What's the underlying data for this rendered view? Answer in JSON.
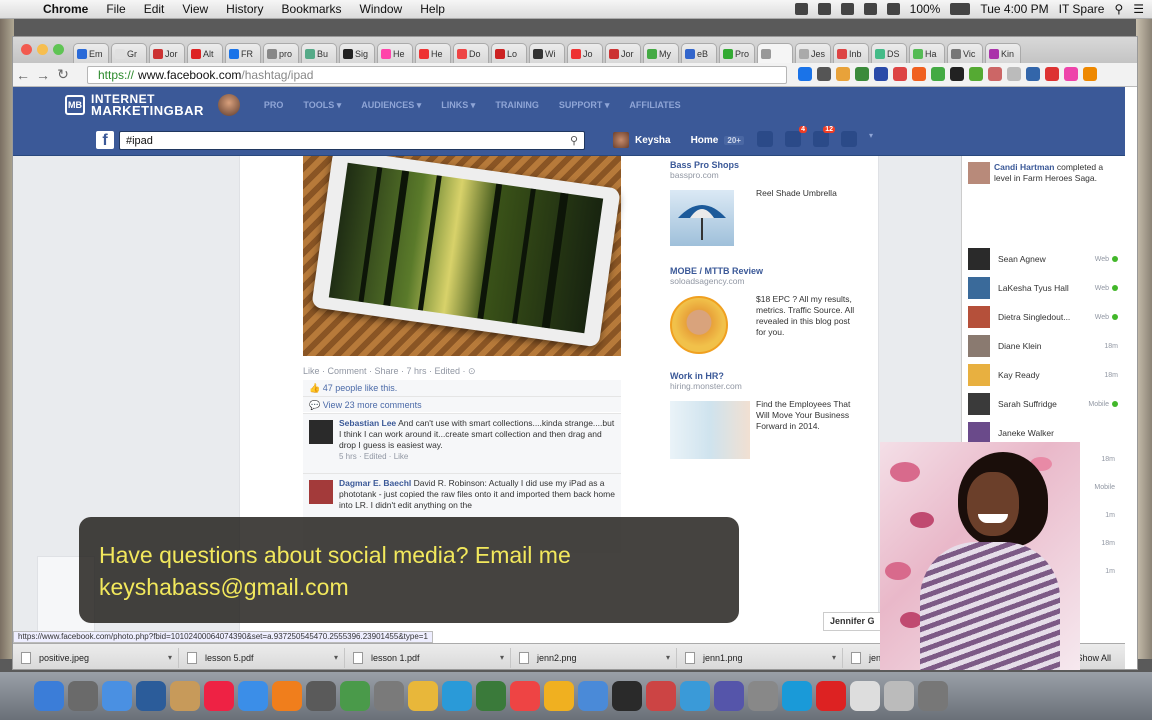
{
  "menubar": {
    "app": "Chrome",
    "items": [
      "File",
      "Edit",
      "View",
      "History",
      "Bookmarks",
      "Window",
      "Help"
    ],
    "battery": "100%",
    "clock": "Tue 4:00 PM",
    "user": "IT Spare"
  },
  "browser": {
    "tabs": [
      "Em",
      "Gr",
      "Jor",
      "Alt",
      "FR",
      "pro",
      "Bu",
      "Sig",
      "He",
      "He",
      "Do",
      "Lo",
      "Wi",
      "Jo",
      "Jor",
      "My",
      "eB",
      "Pro",
      "",
      "Jes",
      "Inb",
      "DS",
      "Ha",
      "Vic",
      "Kin"
    ],
    "url_scheme": "https://",
    "url_host": "www.facebook.com",
    "url_path": "/hashtag/ipad",
    "status_url": "https://www.facebook.com/photo.php?fbid=10102400064074390&set=a.937250545470.2555396.23901455&type=1"
  },
  "imb": {
    "logo_line1": "INTERNET",
    "logo_line2": "MARKETINGBAR",
    "logo_mark": "MB",
    "nav": [
      "PRO",
      "TOOLS ▾",
      "AUDIENCES ▾",
      "LINKS ▾",
      "TRAINING",
      "SUPPORT ▾",
      "AFFILIATES"
    ]
  },
  "fb": {
    "search_value": "#ipad",
    "user_name": "Keysha",
    "home": "Home",
    "home_count": "20+",
    "notif_messages": "4",
    "notif_alerts": "12"
  },
  "post": {
    "actions": "Like · Comment · Share · 7 hrs · Edited · ⊙",
    "likes": "47 people like this.",
    "view_more": "View 23 more comments",
    "comments": [
      {
        "name": "Sebastian Lee",
        "text": "And can't use with smart collections....kinda strange....but I think I can work around it...create smart collection and then drag and drop I guess is easiest way.",
        "meta": "5 hrs · Edited · Like"
      },
      {
        "name": "Dagmar E. Baechl",
        "text": "David R. Robinson: Actually I did use my iPad as a phototank - just copied the raw files onto it and imported them back home into LR. I didn't edit anything on the",
        "meta": ""
      }
    ]
  },
  "ads": [
    {
      "title": "Bass Pro Shops",
      "url": "basspro.com",
      "desc": "Reel Shade Umbrella"
    },
    {
      "title": "MOBE / MTTB Review",
      "url": "soloadsagency.com",
      "desc": "$18 EPC ? All my results, metrics. Traffic Source. All revealed in this blog post for you."
    },
    {
      "title": "Work in HR?",
      "url": "hiring.monster.com",
      "desc": "Find the Employees That Will Move Your Business Forward in 2014."
    }
  ],
  "ticker": {
    "name": "Candi Hartman",
    "text": "completed a level in Farm Heroes Saga."
  },
  "chat": [
    {
      "name": "Sean Agnew",
      "status": "Web"
    },
    {
      "name": "LaKesha Tyus Hall",
      "status": "Web"
    },
    {
      "name": "Dietra Singledout...",
      "status": "Web"
    },
    {
      "name": "Diane Klein",
      "status": "18m"
    },
    {
      "name": "Kay Ready",
      "status": "18m"
    },
    {
      "name": "Sarah Suffridge",
      "status": "Mobile"
    },
    {
      "name": "Janeke Walker",
      "status": ""
    }
  ],
  "chat_minutes": [
    "18m",
    "Mobile",
    "1m",
    "18m",
    "1m"
  ],
  "chatbar": "Jennifer G",
  "downloads": {
    "files": [
      "positive.jpeg",
      "lesson 5.pdf",
      "lesson 1.pdf",
      "jenn2.png",
      "jenn1.png",
      "jenn"
    ],
    "show_all": "Show All"
  },
  "caption": {
    "line1": "Have questions about social media? Email me",
    "line2": "keyshabass@gmail.com"
  }
}
